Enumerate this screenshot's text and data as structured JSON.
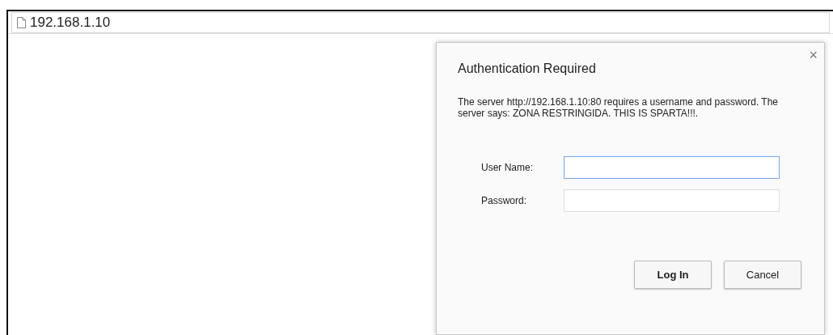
{
  "address_bar": {
    "url": "192.168.1.10"
  },
  "dialog": {
    "title": "Authentication Required",
    "close": "×",
    "message": "The server http://192.168.1.10:80 requires a username and password. The server says: ZONA RESTRINGIDA. THIS IS SPARTA!!!.",
    "fields": [
      {
        "label": "User Name:",
        "focused": true
      },
      {
        "label": "Password:",
        "focused": false
      }
    ],
    "buttons": [
      {
        "label": "Log In",
        "default": true
      },
      {
        "label": "Cancel",
        "default": false
      }
    ]
  }
}
